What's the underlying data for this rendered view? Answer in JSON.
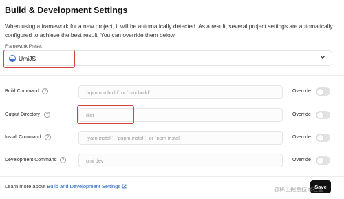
{
  "section": {
    "title": "Build & Development Settings",
    "description": "When using a framework for a new project, it will be automatically detected. As a result, several project settings are automatically configured to achieve the best result. You can override them below."
  },
  "framework": {
    "label": "Framework Preset",
    "value": "UmiJS",
    "logo_icon": "umijs-logo-icon"
  },
  "rows": [
    {
      "label": "Build Command",
      "placeholder": "`npm run build` or `umi build`",
      "override_label": "Override",
      "override_on": false
    },
    {
      "label": "Output Directory",
      "placeholder": "dist",
      "override_label": "Override",
      "override_on": false
    },
    {
      "label": "Install Command",
      "placeholder": "`yarn install`, `pnpm install`, or `npm install`",
      "override_label": "Override",
      "override_on": false
    },
    {
      "label": "Development Command",
      "placeholder": "umi dev",
      "override_label": "Override",
      "override_on": false
    }
  ],
  "footer": {
    "learn_prefix": "Learn more about ",
    "learn_link": "Build and Development Settings",
    "save_label": "Save"
  },
  "watermark": "@稀土掘金技术社区",
  "colors": {
    "highlight": "#d0453e",
    "link": "#1d5fbf",
    "save_bg": "#111111"
  }
}
